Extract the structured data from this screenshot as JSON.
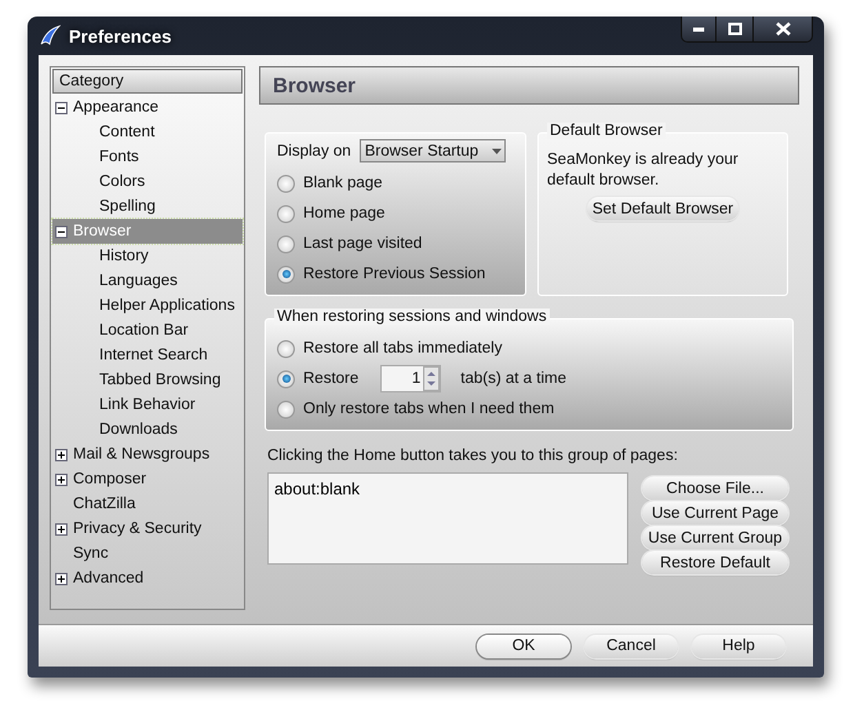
{
  "window": {
    "title": "Preferences"
  },
  "sidebar": {
    "header": "Category",
    "items": [
      {
        "label": "Appearance",
        "expanded": true,
        "selected": false,
        "children": [
          {
            "label": "Content",
            "selected": false
          },
          {
            "label": "Fonts",
            "selected": false
          },
          {
            "label": "Colors",
            "selected": false
          },
          {
            "label": "Spelling",
            "selected": false
          }
        ]
      },
      {
        "label": "Browser",
        "expanded": true,
        "selected": true,
        "children": [
          {
            "label": "History",
            "selected": false
          },
          {
            "label": "Languages",
            "selected": false
          },
          {
            "label": "Helper Applications",
            "selected": false
          },
          {
            "label": "Location Bar",
            "selected": false
          },
          {
            "label": "Internet Search",
            "selected": false
          },
          {
            "label": "Tabbed Browsing",
            "selected": false
          },
          {
            "label": "Link Behavior",
            "selected": false
          },
          {
            "label": "Downloads",
            "selected": false
          }
        ]
      },
      {
        "label": "Mail & Newsgroups",
        "expanded": false,
        "selected": false
      },
      {
        "label": "Composer",
        "expanded": false,
        "selected": false
      },
      {
        "label": "ChatZilla",
        "selected": false
      },
      {
        "label": "Privacy & Security",
        "expanded": false,
        "selected": false
      },
      {
        "label": "Sync",
        "selected": false
      },
      {
        "label": "Advanced",
        "expanded": false,
        "selected": false
      }
    ]
  },
  "page_title": "Browser",
  "display_on": {
    "label": "Display on",
    "dropdown": "Browser Startup",
    "options": [
      {
        "label": "Blank page",
        "selected": false
      },
      {
        "label": "Home page",
        "selected": false
      },
      {
        "label": "Last page visited",
        "selected": false
      },
      {
        "label": "Restore Previous Session",
        "selected": true
      }
    ]
  },
  "default_browser": {
    "title": "Default Browser",
    "message": "SeaMonkey is already your default browser.",
    "button": "Set Default Browser"
  },
  "restoring": {
    "title": "When restoring sessions and windows",
    "options": [
      {
        "kind": "plain",
        "label": "Restore all tabs immediately",
        "selected": false
      },
      {
        "kind": "spinner",
        "label": "Restore",
        "value": "1",
        "suffix": "tab(s) at a time",
        "selected": true
      },
      {
        "kind": "plain",
        "label": "Only restore tabs when I need them",
        "selected": false
      }
    ]
  },
  "home": {
    "label": "Clicking the Home button takes you to this group of pages:",
    "value": "about:blank",
    "buttons": [
      "Choose File...",
      "Use Current Page",
      "Use Current Group",
      "Restore Default"
    ]
  },
  "footer_buttons": [
    {
      "label": "OK",
      "default": true
    },
    {
      "label": "Cancel",
      "default": false
    },
    {
      "label": "Help",
      "default": false
    }
  ]
}
